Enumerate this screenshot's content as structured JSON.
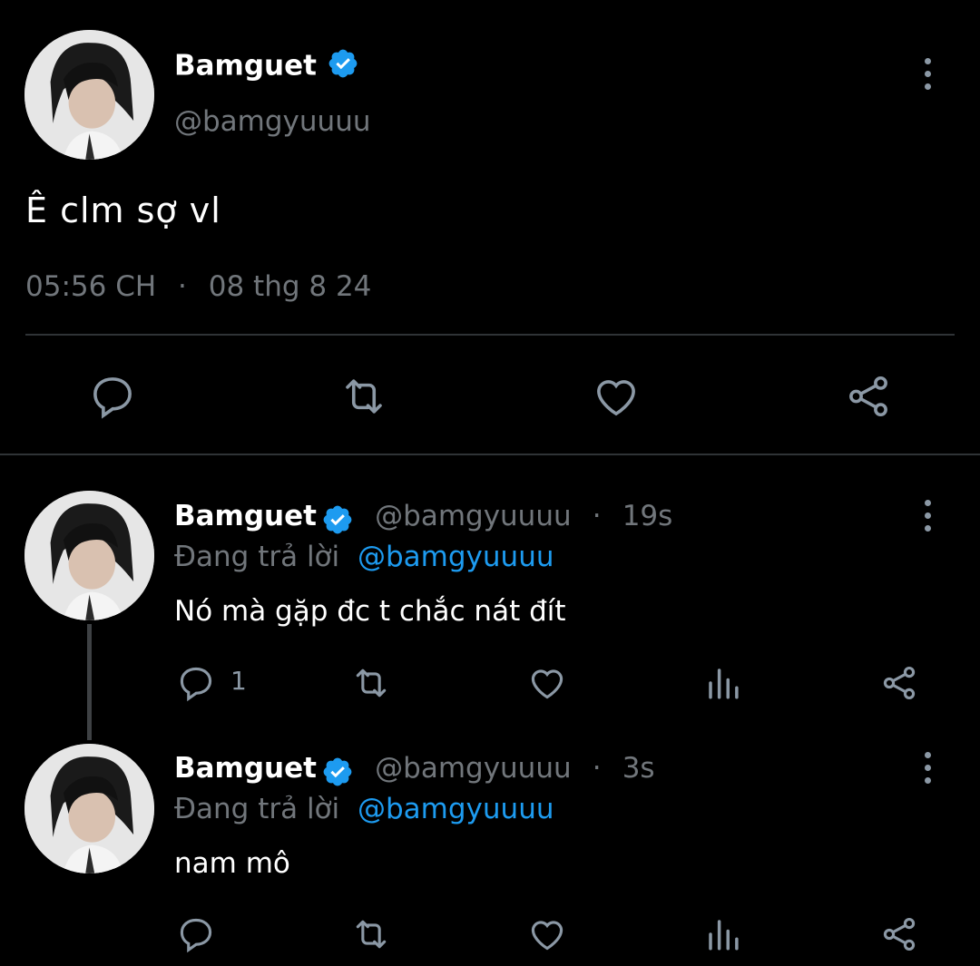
{
  "main_tweet": {
    "display_name": "Bamguet",
    "handle": "@bamgyuuuu",
    "text": "Ê clm sợ vl",
    "time": "05:56 CH",
    "separator": "·",
    "date": "08 thg 8 24"
  },
  "replies": [
    {
      "display_name": "Bamguet",
      "handle": "@bamgyuuuu",
      "separator": "·",
      "age": "19s",
      "replying_label": "Đang trả lời",
      "replying_to": "@bamgyuuuu",
      "text": "Nó mà gặp đc t chắc nát đít",
      "reply_count": "1"
    },
    {
      "display_name": "Bamguet",
      "handle": "@bamgyuuuu",
      "separator": "·",
      "age": "3s",
      "replying_label": "Đang trả lời",
      "replying_to": "@bamgyuuuu",
      "text": "nam mô",
      "reply_count": ""
    }
  ],
  "icons": [
    "reply-icon",
    "retweet-icon",
    "like-icon",
    "share-icon",
    "analytics-icon",
    "verified-badge-icon",
    "more-options-icon"
  ],
  "colors": {
    "background": "#000000",
    "accent": "#1d9bf0",
    "muted": "#71767b",
    "text": "#ffffff"
  }
}
